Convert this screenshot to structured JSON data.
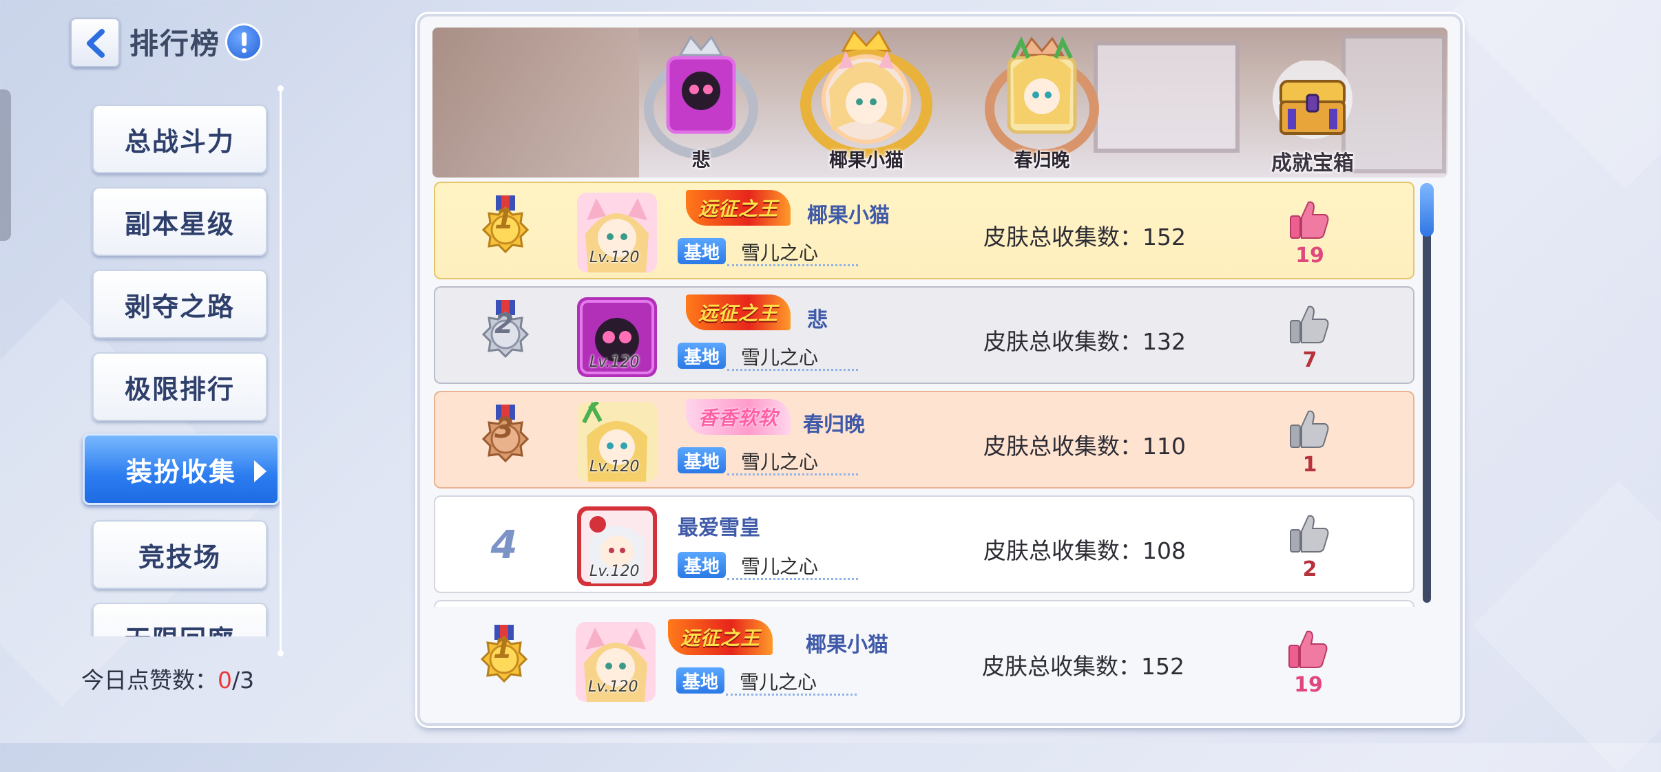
{
  "header": {
    "title": "排行榜"
  },
  "sidebar": {
    "items": [
      {
        "label": "总战斗力",
        "active": false
      },
      {
        "label": "副本星级",
        "active": false
      },
      {
        "label": "剥夺之路",
        "active": false
      },
      {
        "label": "极限排行",
        "active": false
      },
      {
        "label": "装扮收集",
        "active": true
      },
      {
        "label": "竞技场",
        "active": false
      },
      {
        "label": "无限回廊",
        "active": false
      }
    ],
    "likes_today": {
      "label": "今日点赞数：",
      "used": "0",
      "total": "/3"
    }
  },
  "podium": {
    "first": {
      "name": "椰果小猫"
    },
    "second": {
      "name": "悲"
    },
    "third": {
      "name": "春归晚"
    },
    "chest_label": "成就宝箱"
  },
  "rows": [
    {
      "rank": "1",
      "level": "Lv.120",
      "title_badge": "远征之王",
      "player": "椰果小猫",
      "base_tag": "基地",
      "base_name": "雪儿之心",
      "stat_label": "皮肤总收集数：",
      "stat_value": "152",
      "likes": "19",
      "liked": true
    },
    {
      "rank": "2",
      "level": "Lv.120",
      "title_badge": "远征之王",
      "player": "悲",
      "base_tag": "基地",
      "base_name": "雪儿之心",
      "stat_label": "皮肤总收集数：",
      "stat_value": "132",
      "likes": "7",
      "liked": false
    },
    {
      "rank": "3",
      "level": "Lv.120",
      "title_badge": "香香软软",
      "player": "春归晚",
      "base_tag": "基地",
      "base_name": "雪儿之心",
      "stat_label": "皮肤总收集数：",
      "stat_value": "110",
      "likes": "1",
      "liked": false
    },
    {
      "rank": "4",
      "level": "Lv.120",
      "title_badge": "",
      "player": "最爱雪皇",
      "base_tag": "基地",
      "base_name": "雪儿之心",
      "stat_label": "皮肤总收集数：",
      "stat_value": "108",
      "likes": "2",
      "liked": false
    }
  ],
  "self_row": {
    "rank": "1",
    "level": "Lv.120",
    "title_badge": "远征之王",
    "player": "椰果小猫",
    "base_tag": "基地",
    "base_name": "雪儿之心",
    "stat_label": "皮肤总收集数：",
    "stat_value": "152",
    "likes": "19",
    "liked": true
  },
  "colors": {
    "accent_blue": "#2b7cf0",
    "like_pink": "#e0477d",
    "gold": "#f0b83a",
    "silver": "#b8bcc8",
    "bronze": "#d08a5a"
  }
}
